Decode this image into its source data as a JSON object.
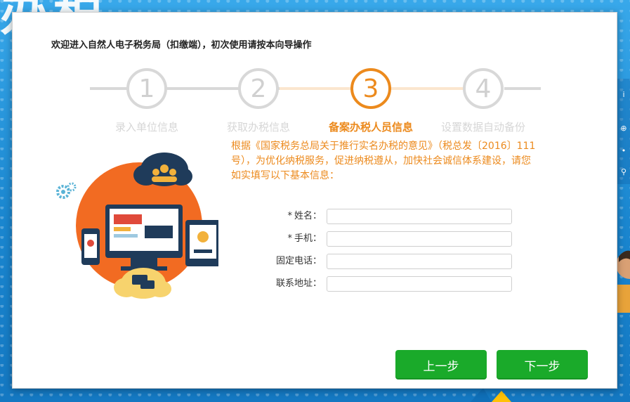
{
  "backdrop": {
    "logo_text": "办税",
    "accent": "#1e8fd6"
  },
  "dialog": {
    "title": "欢迎进入自然人电子税务局（扣缴端），初次使用请按本向导操作"
  },
  "steps": [
    {
      "number": "1",
      "label": "录入单位信息",
      "active": false
    },
    {
      "number": "2",
      "label": "获取办税信息",
      "active": false
    },
    {
      "number": "3",
      "label": "备案办税人员信息",
      "active": true
    },
    {
      "number": "4",
      "label": "设置数据自动备份",
      "active": false
    }
  ],
  "description": "根据《国家税务总局关于推行实名办税的意见》（税总发〔2016〕111号），为优化纳税服务，促进纳税遵从，加快社会诚信体系建设，请您如实填写以下基本信息：",
  "form": {
    "fields": [
      {
        "required_mark": "*",
        "label": "姓名：",
        "value": "",
        "placeholder": ""
      },
      {
        "required_mark": "*",
        "label": "手机：",
        "value": "",
        "placeholder": ""
      },
      {
        "required_mark": "",
        "label": "固定电话：",
        "value": "",
        "placeholder": ""
      },
      {
        "required_mark": "",
        "label": "联系地址：",
        "value": "",
        "placeholder": ""
      }
    ]
  },
  "buttons": {
    "prev": "上一步",
    "next": "下一步"
  },
  "colors": {
    "active_step": "#ec8a1d",
    "inactive_step": "#d8d8d8",
    "button": "#1aaa2a",
    "illus_circle": "#f26b22"
  },
  "icons": {
    "right_strip": [
      "plus-icon",
      "dot-icon",
      "search-icon"
    ]
  }
}
